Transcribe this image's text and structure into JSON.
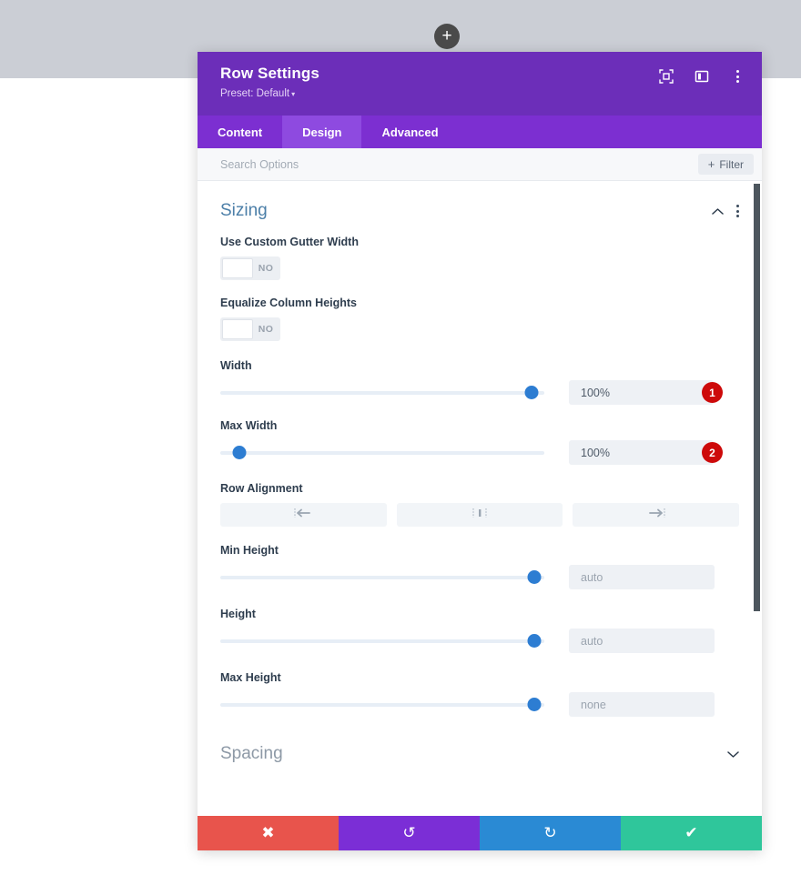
{
  "canvas": {
    "add_button_icon": "plus-icon"
  },
  "modal": {
    "title": "Row Settings",
    "preset_label": "Preset: Default",
    "preset_caret": "▾",
    "header_icons": [
      {
        "name": "focus-frame-icon"
      },
      {
        "name": "panel-layout-icon"
      },
      {
        "name": "more-vertical-icon"
      }
    ],
    "tabs": [
      {
        "label": "Content",
        "active": false
      },
      {
        "label": "Design",
        "active": true
      },
      {
        "label": "Advanced",
        "active": false
      }
    ],
    "search": {
      "placeholder": "Search Options",
      "value": ""
    },
    "filter": {
      "label": "Filter",
      "plus": "+"
    },
    "section": {
      "title": "Sizing",
      "collapse_icon": "chevron-up-icon",
      "menu_icon": "more-vertical-icon"
    },
    "fields": {
      "use_custom_gutter_width": {
        "label": "Use Custom Gutter Width",
        "toggle_value": "NO"
      },
      "equalize_column_heights": {
        "label": "Equalize Column Heights",
        "toggle_value": "NO"
      },
      "width": {
        "label": "Width",
        "value": "100%",
        "slider_percent": 96,
        "badge": "1"
      },
      "max_width": {
        "label": "Max Width",
        "value": "100%",
        "slider_percent": 6,
        "badge": "2"
      },
      "row_alignment": {
        "label": "Row Alignment",
        "options": [
          {
            "name": "align-left-icon",
            "label": "Left"
          },
          {
            "name": "align-center-icon",
            "label": "Center"
          },
          {
            "name": "align-right-icon",
            "label": "Right"
          }
        ]
      },
      "min_height": {
        "label": "Min Height",
        "placeholder": "auto",
        "slider_percent": 97
      },
      "height": {
        "label": "Height",
        "placeholder": "auto",
        "slider_percent": 97
      },
      "max_height": {
        "label": "Max Height",
        "placeholder": "none",
        "slider_percent": 97
      }
    },
    "spacing_section": {
      "title": "Spacing",
      "expand_icon": "chevron-down-icon"
    },
    "actions": [
      {
        "name": "cancel-button",
        "icon": "✖"
      },
      {
        "name": "undo-button",
        "icon": "↺"
      },
      {
        "name": "redo-button",
        "icon": "↻"
      },
      {
        "name": "save-button",
        "icon": "✔"
      }
    ]
  },
  "colors": {
    "header_purple": "#6c2eb9",
    "tab_bar_purple": "#7c2fd1",
    "tab_active_purple": "#8e4ae0",
    "slider_handle_blue": "#2d7dd2",
    "badge_red": "#cd0a0a",
    "cancel_red": "#e8544c",
    "undo_purple": "#7b2ed6",
    "redo_blue": "#2a8ad4",
    "save_green": "#2fc69b",
    "section_title_blue": "#4c7fa8",
    "top_band_gray": "#cbced5"
  }
}
